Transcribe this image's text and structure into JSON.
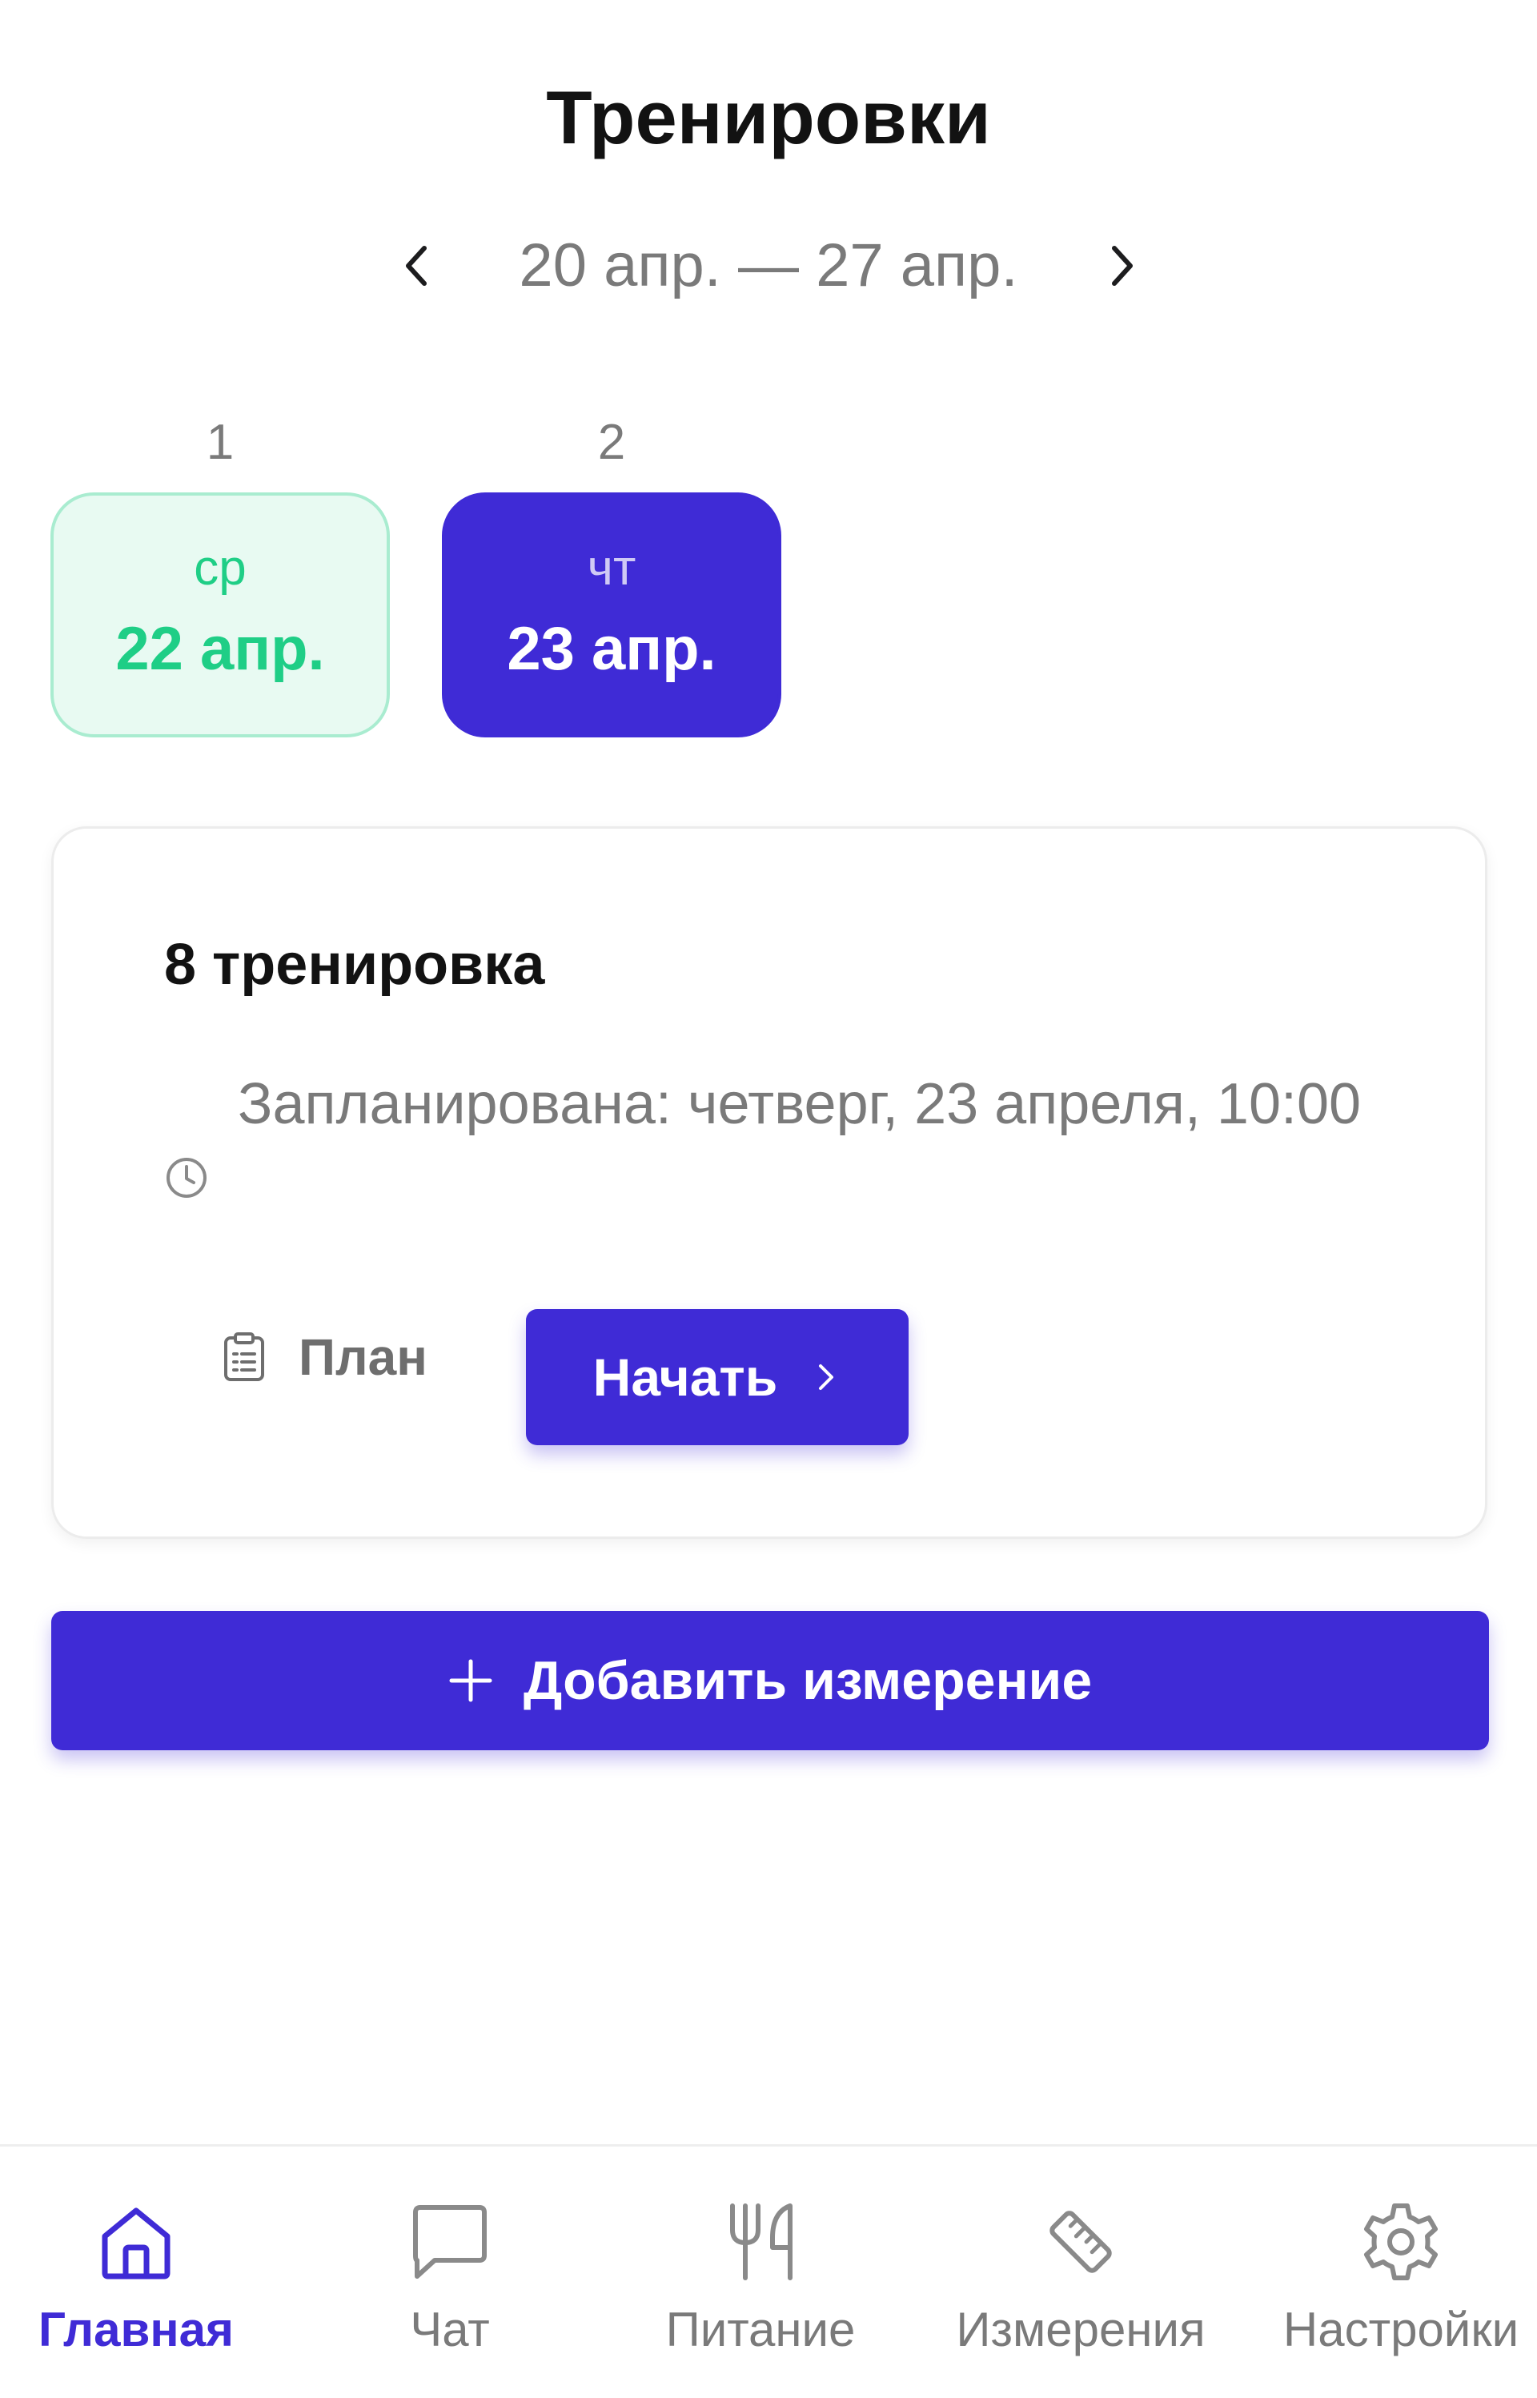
{
  "header": {
    "title": "Тренировки"
  },
  "week": {
    "range": "20 апр. — 27 апр."
  },
  "days": [
    {
      "index": "1",
      "weekday": "ср",
      "date": "22 апр.",
      "status": "done"
    },
    {
      "index": "2",
      "weekday": "чт",
      "date": "23 апр.",
      "status": "active"
    }
  ],
  "workout": {
    "title": "8 тренировка",
    "schedule": "Запланирована: четверг, 23 апреля, 10:00",
    "plan_label": "План",
    "start_label": "Начать"
  },
  "add_measurement": {
    "label": "Добавить измерение"
  },
  "tabs": [
    {
      "label": "Главная",
      "icon": "home-icon",
      "active": true
    },
    {
      "label": "Чат",
      "icon": "chat-icon"
    },
    {
      "label": "Питание",
      "icon": "utensils-icon"
    },
    {
      "label": "Измерения",
      "icon": "ruler-icon"
    },
    {
      "label": "Настройки",
      "icon": "gear-icon"
    }
  ],
  "colors": {
    "accent": "#3f2bd6",
    "done_text": "#1fce86",
    "done_bg": "#e8faf2",
    "muted_text": "#7a7a7a"
  }
}
